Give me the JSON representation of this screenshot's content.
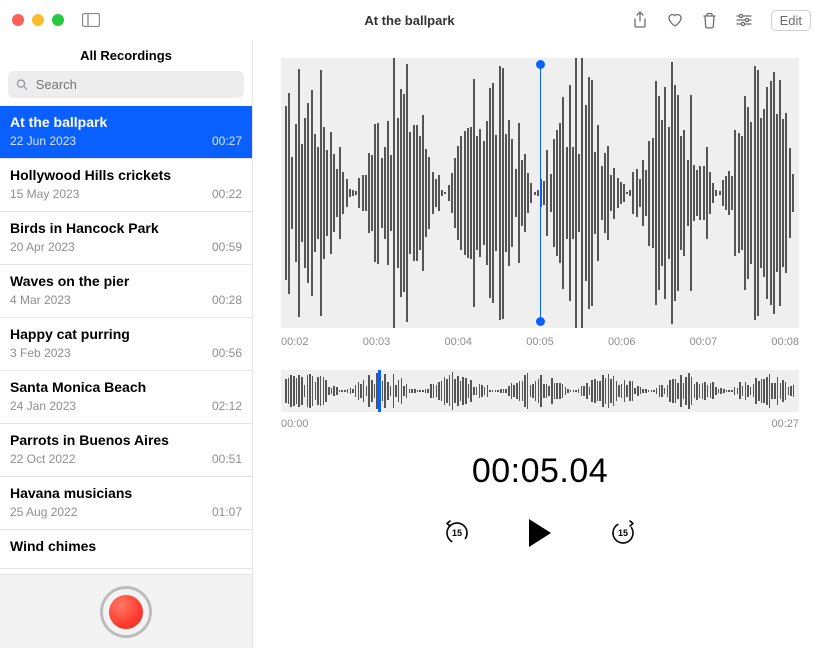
{
  "window": {
    "title": "At the ballpark"
  },
  "toolbar": {
    "edit_label": "Edit"
  },
  "sidebar": {
    "title": "All Recordings",
    "search_placeholder": "Search",
    "recordings": [
      {
        "name": "At the ballpark",
        "date": "22 Jun 2023",
        "duration": "00:27",
        "selected": true
      },
      {
        "name": "Hollywood Hills crickets",
        "date": "15 May 2023",
        "duration": "00:22",
        "selected": false
      },
      {
        "name": "Birds in Hancock Park",
        "date": "20 Apr 2023",
        "duration": "00:59",
        "selected": false
      },
      {
        "name": "Waves on the pier",
        "date": "4 Mar 2023",
        "duration": "00:28",
        "selected": false
      },
      {
        "name": "Happy cat purring",
        "date": "3 Feb 2023",
        "duration": "00:56",
        "selected": false
      },
      {
        "name": "Santa Monica Beach",
        "date": "24 Jan 2023",
        "duration": "02:12",
        "selected": false
      },
      {
        "name": "Parrots in Buenos Aires",
        "date": "22 Oct 2022",
        "duration": "00:51",
        "selected": false
      },
      {
        "name": "Havana musicians",
        "date": "25 Aug 2022",
        "duration": "01:07",
        "selected": false
      },
      {
        "name": "Wind chimes",
        "date": "",
        "duration": "",
        "selected": false
      }
    ]
  },
  "player": {
    "ticks": [
      "00:02",
      "00:03",
      "00:04",
      "00:05",
      "00:06",
      "00:07",
      "00:08"
    ],
    "range_start": "00:00",
    "range_end": "00:27",
    "current_time": "00:05.04",
    "big_playhead_percent": 50,
    "small_playhead_percent": 18.7,
    "skip_seconds": "15"
  }
}
